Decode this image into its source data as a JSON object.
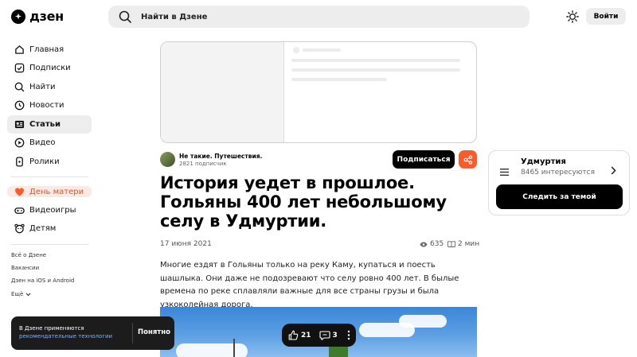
{
  "header": {
    "logo_text": "дзен",
    "search_placeholder": "Найти в Дзене",
    "login_label": "Войти"
  },
  "sidebar": {
    "items": [
      {
        "label": "Главная",
        "icon": "home-icon"
      },
      {
        "label": "Подписки",
        "icon": "subscriptions-icon"
      },
      {
        "label": "Найти",
        "icon": "search-icon"
      },
      {
        "label": "Новости",
        "icon": "news-icon"
      },
      {
        "label": "Статьи",
        "icon": "articles-icon"
      },
      {
        "label": "Видео",
        "icon": "video-icon"
      },
      {
        "label": "Ролики",
        "icon": "clips-icon"
      }
    ],
    "promo": {
      "label": "День матери",
      "icon": "heart-icon"
    },
    "extra": [
      {
        "label": "Видеоигры",
        "icon": "gamepad-icon"
      },
      {
        "label": "Детям",
        "icon": "kids-icon"
      }
    ],
    "footer_links": [
      "Всё о Дзене",
      "Вакансии",
      "Дзен на iOS и Android",
      "Ещё"
    ]
  },
  "article": {
    "channel_name": "Не такие. Путешествия.",
    "channel_subscribers": "2821 подписчик",
    "subscribe_label": "Подписаться",
    "title": "История уедет в прошлое. Гольяны 400 лет небольшому селу в Удмуртии.",
    "date": "17 июня 2021",
    "views": "635",
    "read_time": "2 мин",
    "body": "Многие ездят в Гольяны только на реку Каму, купаться и поесть шашлыка. Они даже не подозревают что селу ровно 400 лет. В былые времена по реке сплавляли важные для все страны грузы и была узкоколейная дорога.",
    "likes": "21",
    "comments": "3"
  },
  "cookie_banner": {
    "text": "В Дзене применяются",
    "link": "рекомендательные технологии",
    "button": "Понятно"
  },
  "topic_card": {
    "name": "Удмуртия",
    "interested": "8465 интересуются",
    "follow_label": "Следить за темой"
  },
  "colors": {
    "accent": "#ff5a2a",
    "promo": "#e2542a",
    "link": "#7bb2ff"
  }
}
